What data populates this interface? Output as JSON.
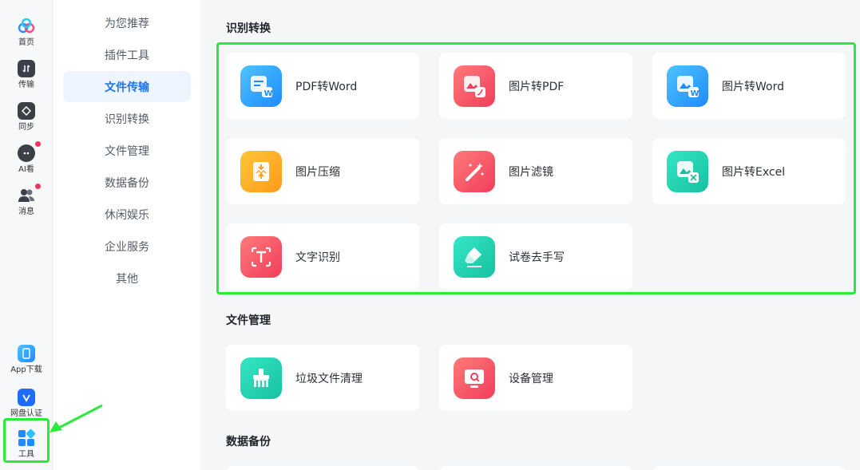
{
  "rail": {
    "items": [
      {
        "label": "首页",
        "icon": "cloud-logo-icon"
      },
      {
        "label": "传输",
        "icon": "transfer-icon"
      },
      {
        "label": "同步",
        "icon": "sync-icon"
      },
      {
        "label": "AI看",
        "icon": "ai-bot-icon",
        "badge": true
      },
      {
        "label": "消息",
        "icon": "messages-icon",
        "badge": true
      }
    ],
    "bottom": [
      {
        "label": "App下载",
        "icon": "phone-icon"
      },
      {
        "label": "网盘认证",
        "icon": "verify-icon"
      },
      {
        "label": "工具",
        "icon": "tools-grid-icon",
        "active": true
      }
    ]
  },
  "categories": [
    "为您推荐",
    "插件工具",
    "文件传输",
    "识别转换",
    "文件管理",
    "数据备份",
    "休闲娱乐",
    "企业服务",
    "其他"
  ],
  "active_category": "文件传输",
  "sections": {
    "recognition": {
      "title": "识别转换",
      "cards": [
        {
          "label": "PDF转Word",
          "icon": "pdf-to-word-icon",
          "color": "blue"
        },
        {
          "label": "图片转PDF",
          "icon": "image-to-pdf-icon",
          "color": "red"
        },
        {
          "label": "图片转Word",
          "icon": "image-to-word-icon",
          "color": "blue"
        },
        {
          "label": "图片压缩",
          "icon": "image-compress-icon",
          "color": "orange"
        },
        {
          "label": "图片滤镜",
          "icon": "image-filter-icon",
          "color": "red"
        },
        {
          "label": "图片转Excel",
          "icon": "image-to-excel-icon",
          "color": "green"
        },
        {
          "label": "文字识别",
          "icon": "text-ocr-icon",
          "color": "red"
        },
        {
          "label": "试卷去手写",
          "icon": "erase-handwriting-icon",
          "color": "green"
        }
      ]
    },
    "file_management": {
      "title": "文件管理",
      "cards": [
        {
          "label": "垃圾文件清理",
          "icon": "broom-cleanup-icon",
          "color": "green"
        },
        {
          "label": "设备管理",
          "icon": "device-manage-icon",
          "color": "red"
        }
      ]
    },
    "backup": {
      "title": "数据备份"
    }
  },
  "colors": {
    "accent": "#1a73ff",
    "highlight": "#2bea3b",
    "badge": "#f5365c"
  }
}
